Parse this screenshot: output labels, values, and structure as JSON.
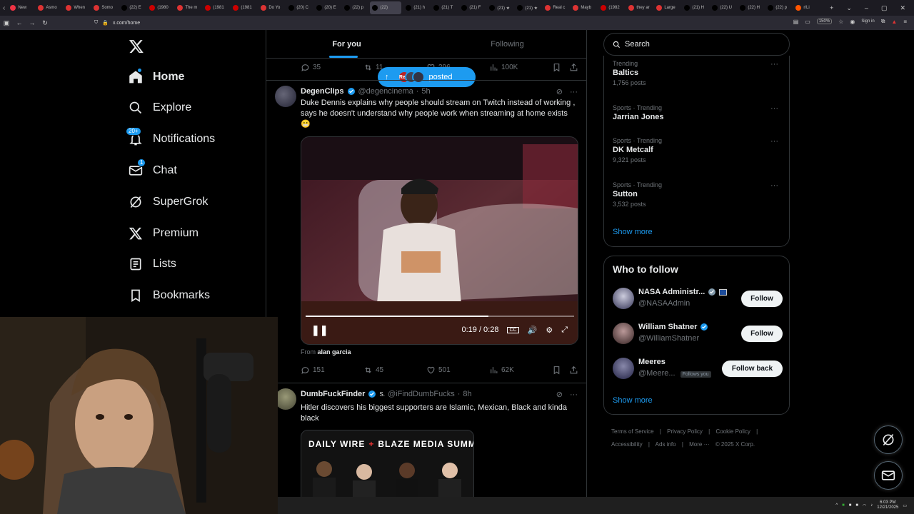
{
  "browser": {
    "tabs": [
      {
        "label": "New",
        "color": "#e34"
      },
      {
        "label": "Asmo",
        "color": "#d33"
      },
      {
        "label": "When",
        "color": "#d33"
      },
      {
        "label": "Somo",
        "color": "#d33"
      },
      {
        "label": "(22) E",
        "color": "#000"
      },
      {
        "label": "(1980",
        "color": "#c00"
      },
      {
        "label": "The m",
        "color": "#d33"
      },
      {
        "label": "(1981",
        "color": "#c00"
      },
      {
        "label": "(1981",
        "color": "#c00"
      },
      {
        "label": "Do Yo",
        "color": "#d33"
      },
      {
        "label": "(20) C",
        "color": "#000"
      },
      {
        "label": "(20) E",
        "color": "#000"
      },
      {
        "label": "(22) p",
        "color": "#000"
      },
      {
        "label": "(22)",
        "color": "#000",
        "active": true
      },
      {
        "label": "(21) h",
        "color": "#000"
      },
      {
        "label": "(21) T",
        "color": "#000"
      },
      {
        "label": "(21) F",
        "color": "#000"
      },
      {
        "label": "(21) ★",
        "color": "#000"
      },
      {
        "label": "(21) ★",
        "color": "#000"
      },
      {
        "label": "Real c",
        "color": "#d33"
      },
      {
        "label": "Mayb",
        "color": "#d33"
      },
      {
        "label": "(1982",
        "color": "#c00"
      },
      {
        "label": "they ar",
        "color": "#d33"
      },
      {
        "label": "Large",
        "color": "#d33"
      },
      {
        "label": "(21) H",
        "color": "#000"
      },
      {
        "label": "(22) U",
        "color": "#000"
      },
      {
        "label": "(22) H",
        "color": "#000"
      },
      {
        "label": "(22) p",
        "color": "#000"
      },
      {
        "label": "r/Li",
        "color": "#f50"
      }
    ],
    "url": "x.com/home",
    "zoom": "150%",
    "signin": "Sign in"
  },
  "nav": {
    "items": [
      {
        "label": "Home",
        "icon": "home-icon"
      },
      {
        "label": "Explore",
        "icon": "search-icon"
      },
      {
        "label": "Notifications",
        "icon": "bell-icon",
        "badge": "20+"
      },
      {
        "label": "Chat",
        "icon": "mail-icon",
        "badge": "1"
      },
      {
        "label": "SuperGrok",
        "icon": "grok-icon"
      },
      {
        "label": "Premium",
        "icon": "x-icon"
      },
      {
        "label": "Lists",
        "icon": "list-icon"
      },
      {
        "label": "Bookmarks",
        "icon": "bookmark-icon"
      }
    ]
  },
  "feed": {
    "tabs": [
      "For you",
      "Following"
    ],
    "prev_actions": {
      "replies": "35",
      "reposts": "11",
      "likes": "296",
      "views": "100K"
    },
    "posted_pill": {
      "label": "posted",
      "avatar_text": "Red"
    },
    "tweet1": {
      "name": "DegenClips",
      "handle": "@degencinema",
      "time": "5h",
      "text": "Duke Dennis explains why people should stream on Twitch instead of working , says he doesn't understand why people work when streaming at home exists 😬",
      "video_time": "0:19 / 0:28",
      "progress": 0.68,
      "from_prefix": "From",
      "from_name": "alan garcia",
      "replies": "151",
      "reposts": "45",
      "likes": "501",
      "views": "62K"
    },
    "tweet2": {
      "name": "DumbFuckFinder",
      "handle": "@iFindDumbFucks",
      "time": "8h",
      "sub_badge": "S.",
      "text": "Hitler discovers his biggest supporters are Islamic, Mexican, Black and kinda black",
      "card_left": "DAILY WIRE",
      "card_plus": "+",
      "card_right": "BLAZE MEDIA SUMMIT"
    }
  },
  "sidebar": {
    "search_placeholder": "Search",
    "trends": [
      {
        "context": "Trending",
        "title": "Baltics",
        "count": "1,756 posts"
      },
      {
        "context": "Sports · Trending",
        "title": "Jarrian Jones",
        "count": ""
      },
      {
        "context": "Sports · Trending",
        "title": "DK Metcalf",
        "count": "9,321 posts"
      },
      {
        "context": "Sports · Trending",
        "title": "Sutton",
        "count": "3,532 posts"
      }
    ],
    "show_more": "Show more",
    "who_to_follow": "Who to follow",
    "follow": [
      {
        "name": "NASA Administr...",
        "handle": "@NASAAdmin",
        "button": "Follow",
        "follows_you": ""
      },
      {
        "name": "William Shatner",
        "handle": "@WilliamShatner",
        "button": "Follow",
        "follows_you": ""
      },
      {
        "name": "Meeres",
        "handle": "@Meere...",
        "button": "Follow back",
        "follows_you": "Follows you"
      }
    ],
    "footer_links": [
      "Terms of Service",
      "|",
      "Privacy Policy",
      "|",
      "Cookie Policy",
      "|",
      "Accessibility",
      "|",
      "Ads info",
      "|",
      "More ···",
      "© 2025 X Corp."
    ]
  },
  "taskbar": {
    "time": "6:03 PM",
    "date": "12/21/2025"
  },
  "colors": {
    "accent": "#1d9bf0",
    "bg": "#000000",
    "border": "#2f3336",
    "muted": "#71767b"
  }
}
